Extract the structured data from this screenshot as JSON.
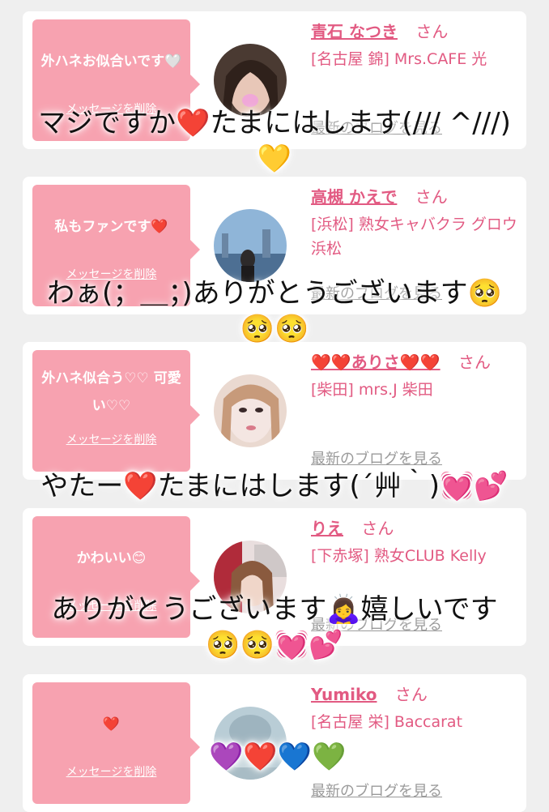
{
  "cards": [
    {
      "message": "外ハネお似合いです🤍",
      "delete_label": "メッセージを削除",
      "name": "青石 なつき",
      "honorific": "さん",
      "shop": "[名古屋 錦] Mrs.CAFE 光",
      "blog_label": "最新のブログを見る"
    },
    {
      "message": "私もファンです❤️",
      "delete_label": "メッセージを削除",
      "name": "高槻 かえで",
      "honorific": "さん",
      "shop": "[浜松] 熟女キャバクラ グロウ 浜松",
      "blog_label": "最新のブログを見る"
    },
    {
      "message": "外ハネ似合う♡♡ 可愛い♡♡",
      "delete_label": "メッセージを削除",
      "name": "❤️❤️ありさ❤️❤️",
      "honorific": "さん",
      "shop": "[柴田] mrs.J 柴田",
      "blog_label": "最新のブログを見る"
    },
    {
      "message": "かわいい😊",
      "delete_label": "メッセージを削除",
      "name": "りえ",
      "honorific": "さん",
      "shop": "[下赤塚] 熟女CLUB Kelly",
      "blog_label": "最新のブログを見る"
    },
    {
      "message": "❤️",
      "delete_label": "メッセージを削除",
      "name": "Yumiko",
      "honorific": "さん",
      "shop": "[名古屋 栄] Baccarat",
      "blog_label": "最新のブログを見る"
    }
  ],
  "overlays": [
    {
      "line1": "マジですか❤️たまにはします(/// ^///)",
      "line2": "💛"
    },
    {
      "line1": "わぁ(；＿；)ありがとうございます🥺",
      "line2": "🥺🥺"
    },
    {
      "line1": "やたー❤️たまにはします(´艸｀)💓💕",
      "line2": ""
    },
    {
      "line1": "ありがとうございます🙇‍♀️嬉しいです",
      "line2": "🥺🥺💓💕"
    },
    {
      "line1": "💜❤️💙💚",
      "line2": ""
    }
  ],
  "colors": {
    "accent_pink": "#e25a82",
    "bubble_pink": "#f7a2b0",
    "background": "#efefef"
  }
}
